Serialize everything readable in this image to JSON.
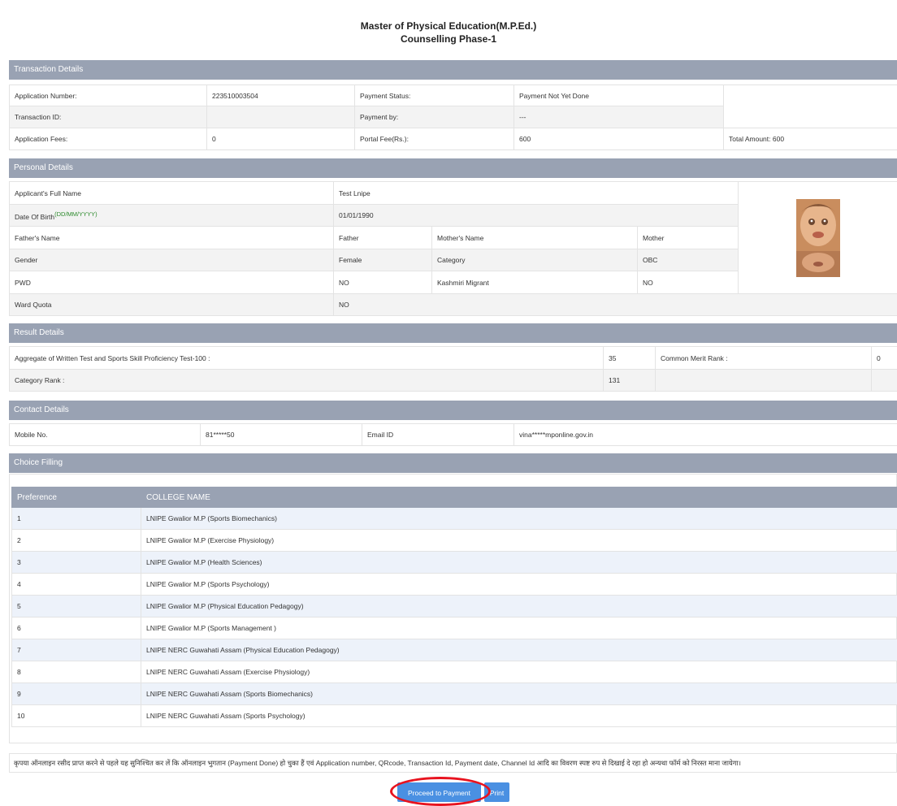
{
  "header": {
    "title": "Master of Physical Education(M.P.Ed.)",
    "subtitle": "Counselling Phase-1"
  },
  "transaction": {
    "heading": "Transaction Details",
    "app_no_label": "Application Number:",
    "app_no_value": "223510003504",
    "payment_status_label": "Payment Status:",
    "payment_status_value": "Payment Not Yet Done",
    "txn_id_label": "Transaction ID:",
    "txn_id_value": "",
    "payment_by_label": "Payment by:",
    "payment_by_value": "---",
    "app_fees_label": "Application Fees:",
    "app_fees_value": "0",
    "portal_fee_label": "Portal Fee(Rs.):",
    "portal_fee_value": "600",
    "total_amount": "Total Amount: 600"
  },
  "personal": {
    "heading": "Personal Details",
    "name_label": "Applicant's Full Name",
    "name_value": "Test Lnipe",
    "dob_label": "Date Of Birth",
    "dob_format": "(DD/MM/YYYY)",
    "dob_value": "01/01/1990",
    "father_label": "Father's Name",
    "father_value": "Father",
    "mother_label": "Mother's Name",
    "mother_value": "Mother",
    "gender_label": "Gender",
    "gender_value": "Female",
    "category_label": "Category",
    "category_value": "OBC",
    "pwd_label": "PWD",
    "pwd_value": "NO",
    "kashmiri_label": "Kashmiri Migrant",
    "kashmiri_value": "NO",
    "ward_label": "Ward Quota",
    "ward_value": "NO"
  },
  "result": {
    "heading": "Result Details",
    "aggregate_label": "Aggregate of Written Test and Sports Skill Proficiency Test-100 :",
    "aggregate_value": "35",
    "merit_label": "Common Merit Rank :",
    "merit_value": "0",
    "category_rank_label": "Category Rank :",
    "category_rank_value": "131"
  },
  "contact": {
    "heading": "Contact Details",
    "mobile_label": "Mobile No.",
    "mobile_value": "81*****50",
    "email_label": "Email ID",
    "email_value": "vina*****mponline.gov.in"
  },
  "choice": {
    "heading": "Choice Filling",
    "col_pref": "Preference",
    "col_college": "COLLEGE NAME",
    "rows": [
      {
        "pref": "1",
        "college": "LNIPE Gwalior M.P (Sports Biomechanics)"
      },
      {
        "pref": "2",
        "college": "LNIPE Gwalior M.P (Exercise Physiology)"
      },
      {
        "pref": "3",
        "college": "LNIPE Gwalior M.P (Health Sciences)"
      },
      {
        "pref": "4",
        "college": "LNIPE Gwalior M.P (Sports Psychology)"
      },
      {
        "pref": "5",
        "college": "LNIPE Gwalior M.P (Physical Education Pedagogy)"
      },
      {
        "pref": "6",
        "college": "LNIPE Gwalior M.P (Sports Management )"
      },
      {
        "pref": "7",
        "college": "LNIPE NERC Guwahati Assam (Physical Education Pedagogy)"
      },
      {
        "pref": "8",
        "college": "LNIPE NERC Guwahati Assam (Exercise Physiology)"
      },
      {
        "pref": "9",
        "college": "LNIPE NERC Guwahati Assam (Sports Biomechanics)"
      },
      {
        "pref": "10",
        "college": "LNIPE NERC Guwahati Assam (Sports Psychology)"
      }
    ]
  },
  "notice": "कृपया ऑनलाइन रसीद प्राप्त करने से पहले यह सुनिश्चित कर लें कि ऑनलाइन भुगतान (Payment Done) हो चुका हैं एवं Application number, QRcode, Transaction Id, Payment date, Channel Id आदि का विवरण स्पष्ट रुप से दिखाई दे रहा हो अन्यथा फॉर्म को निरस्त माना जायेगा।",
  "buttons": {
    "proceed": "Proceed  to Payment",
    "print": "Print"
  },
  "colors": {
    "section_header": "#99a2b3",
    "button": "#4a90e2",
    "highlight_oval": "#e8131f",
    "required_label": "#e8263b"
  }
}
